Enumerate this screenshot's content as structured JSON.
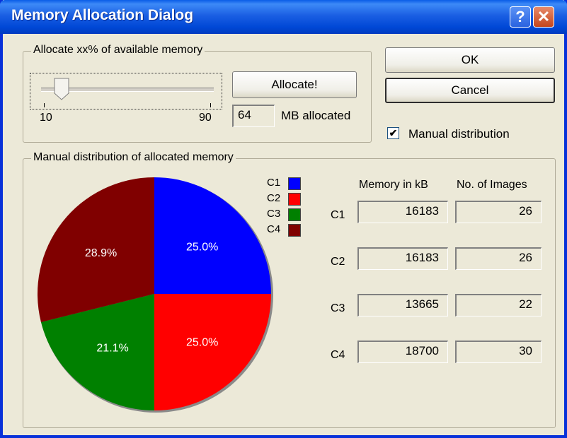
{
  "window": {
    "title": "Memory Allocation Dialog",
    "help_glyph": "?",
    "close_glyph": "✕"
  },
  "allocate_group": {
    "legend": "Allocate xx% of available memory",
    "slider": {
      "min_label": "10",
      "max_label": "90",
      "min": 10,
      "max": 90,
      "value": 18
    },
    "allocate_button": "Allocate!",
    "mb_value": "64",
    "mb_label": "MB allocated"
  },
  "buttons": {
    "ok": "OK",
    "cancel": "Cancel"
  },
  "manual_checkbox": {
    "label": "Manual distribution",
    "checked": true,
    "mark": "✔"
  },
  "distribution_group": {
    "legend": "Manual distribution of allocated memory",
    "col_memory": "Memory in kB",
    "col_images": "No. of Images",
    "rows": [
      {
        "label": "C1",
        "memory": "16183",
        "images": "26"
      },
      {
        "label": "C2",
        "memory": "16183",
        "images": "26"
      },
      {
        "label": "C3",
        "memory": "13665",
        "images": "22"
      },
      {
        "label": "C4",
        "memory": "18700",
        "images": "30"
      }
    ]
  },
  "chart_data": {
    "type": "pie",
    "categories": [
      "C1",
      "C2",
      "C3",
      "C4"
    ],
    "values": [
      25.0,
      25.0,
      21.1,
      28.9
    ],
    "labels": [
      "25.0%",
      "25.0%",
      "21.1%",
      "28.9%"
    ],
    "colors": [
      "#0000ff",
      "#ff0000",
      "#008000",
      "#800000"
    ],
    "legend": [
      "C1",
      "C2",
      "C3",
      "C4"
    ]
  }
}
